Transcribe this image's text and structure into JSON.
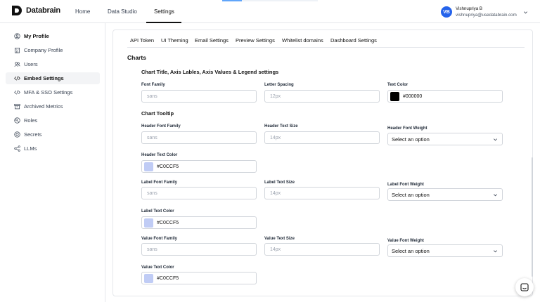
{
  "app": {
    "name": "Databrain"
  },
  "nav": {
    "home": "Home",
    "data_studio": "Data Studio",
    "settings": "Settings"
  },
  "user": {
    "initials": "VB",
    "name": "Vishnupriya B",
    "email": "vishnupriya@usedatabrain.com"
  },
  "sidebar": {
    "items": [
      {
        "label": "My Profile",
        "icon": "user-circle-icon"
      },
      {
        "label": "Company Profile",
        "icon": "building-icon"
      },
      {
        "label": "Users",
        "icon": "users-icon"
      },
      {
        "label": "Embed Settings",
        "icon": "code-icon"
      },
      {
        "label": "MFA & SSO Settings",
        "icon": "code-icon"
      },
      {
        "label": "Archived Metrics",
        "icon": "archive-icon"
      },
      {
        "label": "Roles",
        "icon": "roles-icon"
      },
      {
        "label": "Secrets",
        "icon": "secret-icon"
      },
      {
        "label": "LLMs",
        "icon": "share-nodes-icon"
      }
    ],
    "active": "Embed Settings"
  },
  "tabs": [
    "API Token",
    "UI Theming",
    "Email Settings",
    "Preview Settings",
    "Whitelist domains",
    "Dashboard Settings"
  ],
  "section_title": "Charts",
  "general": {
    "title": "Chart Title, Axis Lables, Axis Values & Legend settings",
    "font_family_label": "Font Family",
    "font_family_placeholder": "sans",
    "letter_spacing_label": "Letter Spacing",
    "letter_spacing_placeholder": "12px",
    "text_color_label": "Text Color",
    "text_color_value": "#000000"
  },
  "tooltip": {
    "title": "Chart Tooltip",
    "header_font_family_label": "Header Font Family",
    "header_font_family_placeholder": "sans",
    "header_text_size_label": "Header Text Size",
    "header_text_size_placeholder": "14px",
    "header_font_weight_label": "Header Font Weight",
    "header_font_weight_value": "Select an option",
    "header_text_color_label": "Header Text Color",
    "header_text_color_value": "#C0CCF5",
    "label_font_family_label": "Label Font Family",
    "label_font_family_placeholder": "sans",
    "label_text_size_label": "Label Text Size",
    "label_text_size_placeholder": "14px",
    "label_font_weight_label": "Label Font Weight",
    "label_font_weight_value": "Select an option",
    "label_text_color_label": "Label Text Color",
    "label_text_color_value": "#C0CCF5",
    "value_font_family_label": "Value Font Family",
    "value_font_family_placeholder": "sans",
    "value_text_size_label": "Value Text Size",
    "value_text_size_placeholder": "14px",
    "value_font_weight_label": "Value Font Weight",
    "value_font_weight_value": "Select an option",
    "value_text_color_label": "Value Text Color",
    "value_text_color_value": "#C0CCF5"
  },
  "colors": {
    "accent": "#2563eb",
    "black_swatch": "#000000",
    "tooltip_swatch": "#C0CCF5"
  }
}
